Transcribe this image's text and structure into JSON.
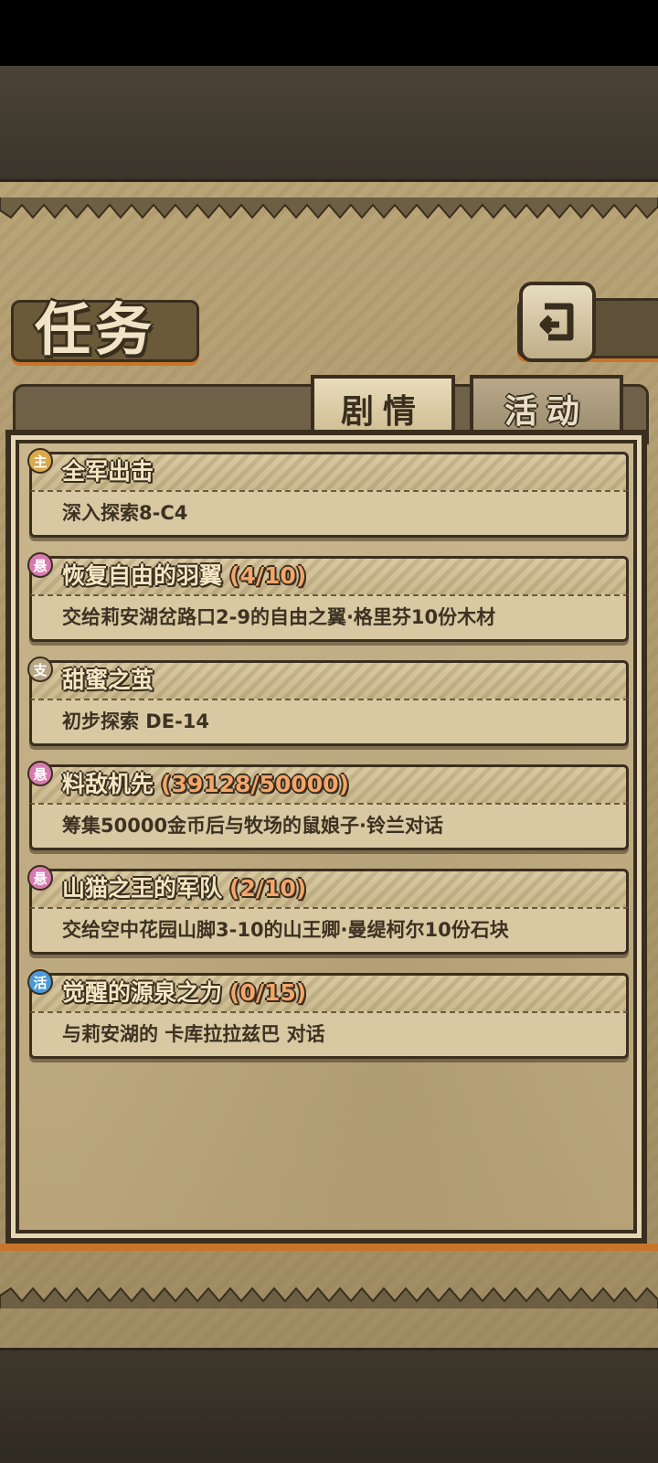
{
  "header": {
    "title": "任务",
    "back_icon": "return-arrow-icon"
  },
  "tabs": [
    {
      "label": "剧情",
      "active": true
    },
    {
      "label": "活动",
      "active": false
    }
  ],
  "quests": [
    {
      "badge": "主",
      "badge_color": "#d9a94a",
      "title": "全军出击",
      "progress": "",
      "description": "深入探索8-C4"
    },
    {
      "badge": "悬",
      "badge_color": "#d87ab0",
      "title": "恢复自由的羽翼",
      "progress": "(4/10)",
      "description": "交给莉安湖岔路口2-9的自由之翼·格里芬10份木材"
    },
    {
      "badge": "支",
      "badge_color": "#b7a682",
      "title": "甜蜜之茧",
      "progress": "",
      "description": "初步探索 DE-14"
    },
    {
      "badge": "悬",
      "badge_color": "#d87ab0",
      "title": "料敌机先",
      "progress": "(39128/50000)",
      "description": "筹集50000金币后与牧场的鼠娘子·铃兰对话"
    },
    {
      "badge": "悬",
      "badge_color": "#d87ab0",
      "title": "山猫之王的军队",
      "progress": "(2/10)",
      "description": "交给空中花园山脚3-10的山王卿·曼缇柯尔10份石块"
    },
    {
      "badge": "活",
      "badge_color": "#4a9ad8",
      "title": "觉醒的源泉之力",
      "progress": "(0/15)",
      "description": "与莉安湖的 卡库拉拉兹巴 对话"
    }
  ]
}
